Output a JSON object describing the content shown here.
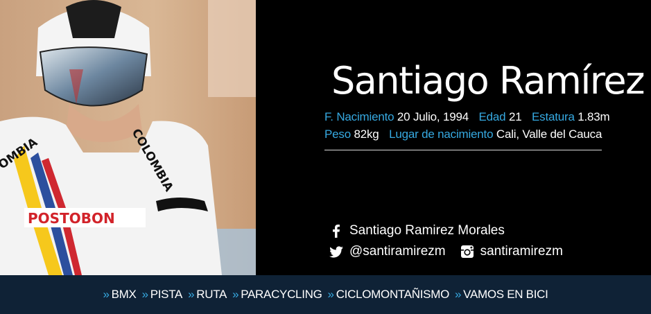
{
  "athlete": {
    "name": "Santiago Ramírez",
    "photo_alt": "Ciclista con casco aerodinámico y uniforme de Colombia",
    "facts": {
      "birth": {
        "label": "F. Nacimiento",
        "value": "20 Julio, 1994"
      },
      "age": {
        "label": "Edad",
        "value": "21"
      },
      "height": {
        "label": "Estatura",
        "value": "1.83m"
      },
      "weight": {
        "label": "Peso",
        "value": "82kg"
      },
      "birthplace": {
        "label": "Lugar de nacimiento",
        "value": "Cali, Valle del Cauca"
      }
    }
  },
  "social": {
    "facebook": {
      "icon": "facebook-icon",
      "label": "Santiago Ramirez Morales"
    },
    "twitter": {
      "icon": "twitter-icon",
      "label": "@santiramirezm"
    },
    "instagram": {
      "icon": "instagram-icon",
      "label": "santiramirezm"
    }
  },
  "nav": {
    "chevron": "»",
    "items": [
      "BMX",
      "PISTA",
      "RUTA",
      "PARACYCLING",
      "CICLOMONTAÑISMO",
      "VAMOS EN BICI"
    ]
  },
  "colors": {
    "accent": "#36a9e1",
    "nav_bg": "#0f2236",
    "background": "#000000"
  }
}
